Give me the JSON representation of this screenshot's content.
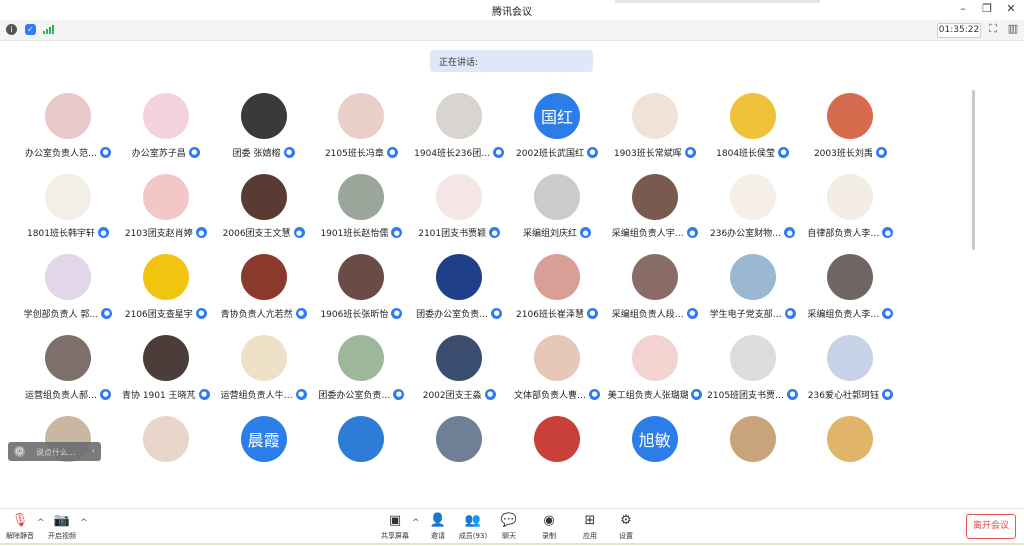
{
  "window": {
    "title": "腾讯会议"
  },
  "meeting": {
    "timer": "01:35:22",
    "speaking_label": "正在讲话:"
  },
  "participants": [
    {
      "name": "办公室负责人范…"
    },
    {
      "name": "办公室苏子昌"
    },
    {
      "name": "团委  张婧榕"
    },
    {
      "name": "2105班长冯章"
    },
    {
      "name": "1904班长236团…"
    },
    {
      "name": "2002班长武国红",
      "avatar_text": "国红",
      "avatar_color": "#2b7de9"
    },
    {
      "name": "1903班长常斌晖"
    },
    {
      "name": "1804班长侯莹"
    },
    {
      "name": "2003班长刘禹"
    },
    {
      "name": "1801班长韩宇轩"
    },
    {
      "name": "2103团支赵肖婷"
    },
    {
      "name": "2006团支王文慧"
    },
    {
      "name": "1901班长赵怡儒"
    },
    {
      "name": "2101团支书贾颖"
    },
    {
      "name": "采编组刘庆红"
    },
    {
      "name": "采编组负责人宇…"
    },
    {
      "name": "236办公室财物…"
    },
    {
      "name": "自律部负责人李…"
    },
    {
      "name": "学创部负责人 郭…"
    },
    {
      "name": "2106团支查星宇"
    },
    {
      "name": "青协负责人亢若然"
    },
    {
      "name": "1906班长张昕怡"
    },
    {
      "name": "团委办公室负责…"
    },
    {
      "name": "2106班长崔泽慧"
    },
    {
      "name": "采编组负责人段…"
    },
    {
      "name": "学生电子党支部…"
    },
    {
      "name": "采编组负责人李…"
    },
    {
      "name": "运营组负责人郝…"
    },
    {
      "name": "青协 1901 王晓芃"
    },
    {
      "name": "运营组负责人牛…"
    },
    {
      "name": "团委办公室负责…"
    },
    {
      "name": "2002团支王淼"
    },
    {
      "name": "文体部负责人曹…"
    },
    {
      "name": "美工组负责人张璐璐"
    },
    {
      "name": "2105班团支书贾…"
    },
    {
      "name": "236爱心社郭珂钰"
    },
    {},
    {},
    {
      "avatar_text": "晨霞",
      "avatar_color": "#2b7de9"
    },
    {},
    {},
    {},
    {
      "avatar_text": "旭敏",
      "avatar_color": "#2b7de9"
    },
    {},
    {}
  ],
  "chat": {
    "placeholder": "说点什么..."
  },
  "toolbar": {
    "unmute": "解除静音",
    "start_video": "开启视频",
    "share_screen": "共享屏幕",
    "invite": "邀请",
    "members": "成员(93)",
    "chat": "聊天",
    "record": "录制",
    "apps": "应用",
    "settings": "设置",
    "leave": "离开会议"
  },
  "colors": {
    "accent": "#2f7bf5",
    "leave": "#e04545"
  }
}
